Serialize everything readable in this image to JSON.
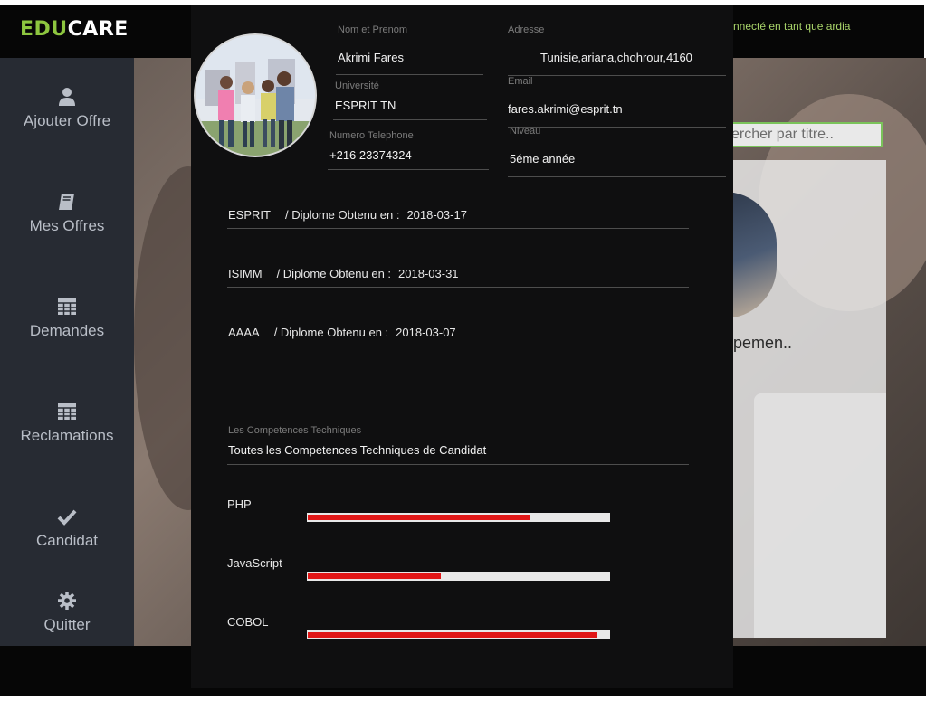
{
  "topbar": {
    "logo_part1": "EDU",
    "logo_part2": "CARE",
    "connected_text": "nnecté en tant que ardia"
  },
  "sidebar": {
    "items": [
      {
        "label": "Ajouter Offre",
        "icon": "user-icon"
      },
      {
        "label": "Mes Offres",
        "icon": "book-icon"
      },
      {
        "label": "Demandes",
        "icon": "table-icon"
      },
      {
        "label": "Reclamations",
        "icon": "table-icon"
      },
      {
        "label": "Candidat",
        "icon": "check-icon"
      },
      {
        "label": "Quitter",
        "icon": "gear-icon"
      }
    ]
  },
  "background": {
    "search_placeholder": "ercher par titre..",
    "card_text": "pemen.."
  },
  "profile": {
    "name_label": "Nom et Prenom",
    "name": "Akrimi Fares",
    "address_label": "Adresse",
    "address": "Tunisie,ariana,chohrour,4160",
    "university_label": "Université",
    "university": "ESPRIT TN",
    "email_label": "Email",
    "email": "fares.akrimi@esprit.tn",
    "phone_label": "Numero Telephone",
    "phone": "+216 23374324",
    "level_label": "Niveau",
    "level": "5éme année"
  },
  "diplomas": {
    "separator": "/ Diplome Obtenu en :",
    "items": [
      {
        "school": "ESPRIT",
        "date": "2018-03-17"
      },
      {
        "school": "ISIMM",
        "date": "2018-03-31"
      },
      {
        "school": "AAAA",
        "date": "2018-03-07"
      }
    ]
  },
  "competences": {
    "label": "Les Competences Techniques",
    "summary": "Toutes les Competences Techniques de Candidat",
    "skills": [
      {
        "name": "PHP",
        "level": 0.74
      },
      {
        "name": "JavaScript",
        "level": 0.44
      },
      {
        "name": "COBOL",
        "level": 0.96
      }
    ]
  },
  "colors": {
    "accent_green": "#8dc63f",
    "skill_fill": "#e01616",
    "modal_bg": "#0f0f10",
    "sidebar_bg": "#272b33"
  }
}
